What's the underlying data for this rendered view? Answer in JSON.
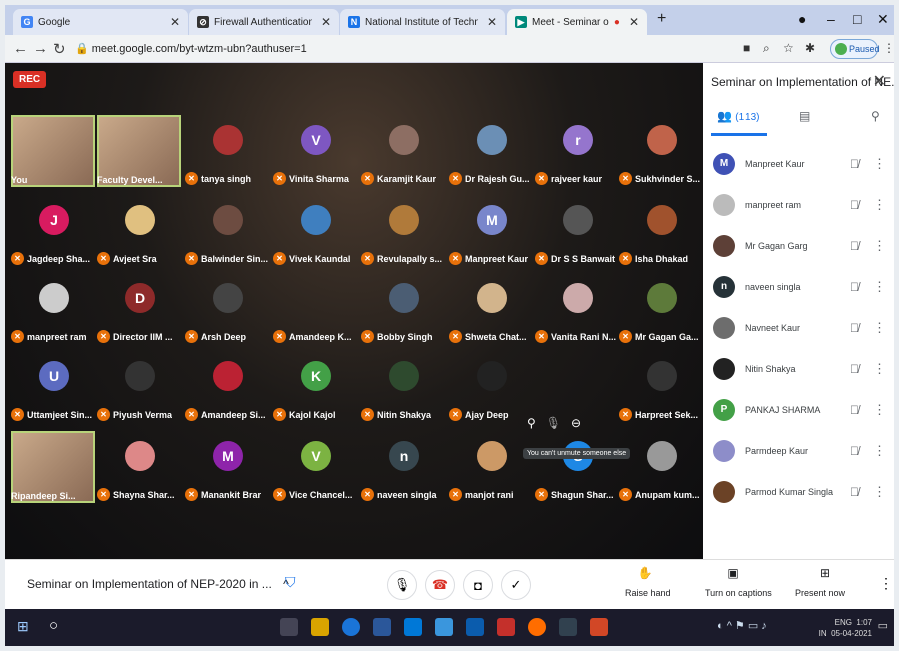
{
  "browser": {
    "tabs": [
      {
        "label": "Google",
        "color": "#4285f4",
        "glyph": "G"
      },
      {
        "label": "Firewall Authentication Keepalive",
        "color": "#333",
        "glyph": "⊘"
      },
      {
        "label": "National Institute of Technical Te",
        "color": "#1a73e8",
        "glyph": "N"
      },
      {
        "label": "Meet - Seminar on Impleme",
        "color": "#00897b",
        "glyph": "▶"
      }
    ],
    "new_tab": "+",
    "url": "meet.google.com/byt-wtzm-ubn?authuser=1",
    "paused_label": "Paused"
  },
  "meet": {
    "rec_label": "REC",
    "tooltip": "You can't unmute someone else",
    "tiles": [
      {
        "name": "You",
        "type": "video"
      },
      {
        "name": "Faculty Devel...",
        "type": "video"
      },
      {
        "name": "tanya singh",
        "type": "photo",
        "color": "#a33"
      },
      {
        "name": "Vinita Sharma",
        "type": "letter",
        "letter": "V",
        "color": "#7e57c2"
      },
      {
        "name": "Karamjit Kaur",
        "type": "photo",
        "color": "#8d6e63"
      },
      {
        "name": "Dr Rajesh Gu...",
        "type": "photo",
        "color": "#6b8fb5"
      },
      {
        "name": "rajveer kaur",
        "type": "letter",
        "letter": "r",
        "color": "#9575cd"
      },
      {
        "name": "Sukhvinder S...",
        "type": "photo",
        "color": "#c0634a"
      },
      {
        "name": "Jagdeep Sha...",
        "type": "letter",
        "letter": "J",
        "color": "#d81b60"
      },
      {
        "name": "Avjeet Sra",
        "type": "photo",
        "color": "#e0c080"
      },
      {
        "name": "Balwinder Sin...",
        "type": "photo",
        "color": "#6d4c41"
      },
      {
        "name": "Vivek Kaundal",
        "type": "photo",
        "color": "#3f7fbf"
      },
      {
        "name": "Revulapally s...",
        "type": "photo",
        "color": "#b07a3a"
      },
      {
        "name": "Manpreet Kaur",
        "type": "letter",
        "letter": "M",
        "color": "#7986cb"
      },
      {
        "name": "Dr S S Banwait",
        "type": "photo",
        "color": "#555"
      },
      {
        "name": "Isha Dhakad",
        "type": "photo",
        "color": "#a0522d"
      },
      {
        "name": "manpreet ram",
        "type": "photo",
        "color": "#ccc"
      },
      {
        "name": "Director IIM ...",
        "type": "letter",
        "letter": "D",
        "color": "#8e2a2a"
      },
      {
        "name": "Arsh Deep",
        "type": "photo",
        "color": "#444"
      },
      {
        "name": "Amandeep K...",
        "type": "none",
        "color": "#000"
      },
      {
        "name": "Bobby Singh",
        "type": "photo",
        "color": "#4b5d73"
      },
      {
        "name": "Shweta Chat...",
        "type": "photo",
        "color": "#d2b48c"
      },
      {
        "name": "Vanita Rani N...",
        "type": "photo",
        "color": "#caa"
      },
      {
        "name": "Mr Gagan Ga...",
        "type": "photo",
        "color": "#5d7a3a"
      },
      {
        "name": "Uttamjeet Sin...",
        "type": "letter",
        "letter": "U",
        "color": "#5c6bc0"
      },
      {
        "name": "Piyush Verma",
        "type": "photo",
        "color": "#333"
      },
      {
        "name": "Amandeep Si...",
        "type": "photo",
        "color": "#b23"
      },
      {
        "name": "Kajol Kajol",
        "type": "letter",
        "letter": "K",
        "color": "#43a047"
      },
      {
        "name": "Nitin Shakya",
        "type": "photo",
        "color": "#2e4a2e"
      },
      {
        "name": "Ajay Deep",
        "type": "photo",
        "color": "#222"
      },
      {
        "name": "",
        "type": "controls",
        "color": "#000"
      },
      {
        "name": "Harpreet Sek...",
        "type": "photo",
        "color": "#333"
      },
      {
        "name": "Ripandeep Si...",
        "type": "video"
      },
      {
        "name": "Shayna Shar...",
        "type": "photo",
        "color": "#d88"
      },
      {
        "name": "Manankit Brar",
        "type": "letter",
        "letter": "M",
        "color": "#8e24aa"
      },
      {
        "name": "Vice Chancel...",
        "type": "letter",
        "letter": "V",
        "color": "#7cb342"
      },
      {
        "name": "naveen singla",
        "type": "letter",
        "letter": "n",
        "color": "#37474f"
      },
      {
        "name": "manjot rani",
        "type": "photo",
        "color": "#c96"
      },
      {
        "name": "Shagun Shar...",
        "type": "letter",
        "letter": "S",
        "color": "#1e88e5"
      },
      {
        "name": "Anupam kum...",
        "type": "photo",
        "color": "#999"
      }
    ]
  },
  "panel": {
    "title": "Seminar on Implementation of NE...",
    "people_count": "(1 13)",
    "people": [
      {
        "name": "Manpreet Kaur",
        "letter": "M",
        "color": "#3f51b5"
      },
      {
        "name": "manpreet ram",
        "letter": "",
        "color": "#bbb"
      },
      {
        "name": "Mr Gagan Garg",
        "letter": "",
        "color": "#5d4037"
      },
      {
        "name": "naveen singla",
        "letter": "n",
        "color": "#263238"
      },
      {
        "name": "Navneet Kaur",
        "letter": "",
        "color": "#6d6d6d"
      },
      {
        "name": "Nitin Shakya",
        "letter": "",
        "color": "#222"
      },
      {
        "name": "PANKAJ SHARMA",
        "letter": "P",
        "color": "#43a047"
      },
      {
        "name": "Parmdeep Kaur",
        "letter": "",
        "color": "#8d8dc9"
      },
      {
        "name": "Parmod Kumar Singla",
        "letter": "",
        "color": "#6b4226"
      }
    ]
  },
  "bottom": {
    "meeting_title": "Seminar on Implementation of NEP-2020 in ...",
    "raise_hand": "Raise hand",
    "captions": "Turn on captions",
    "present": "Present now"
  },
  "taskbar": {
    "lang": "ENG",
    "region": "IN",
    "time": "1:07",
    "date": "05-04-2021"
  }
}
